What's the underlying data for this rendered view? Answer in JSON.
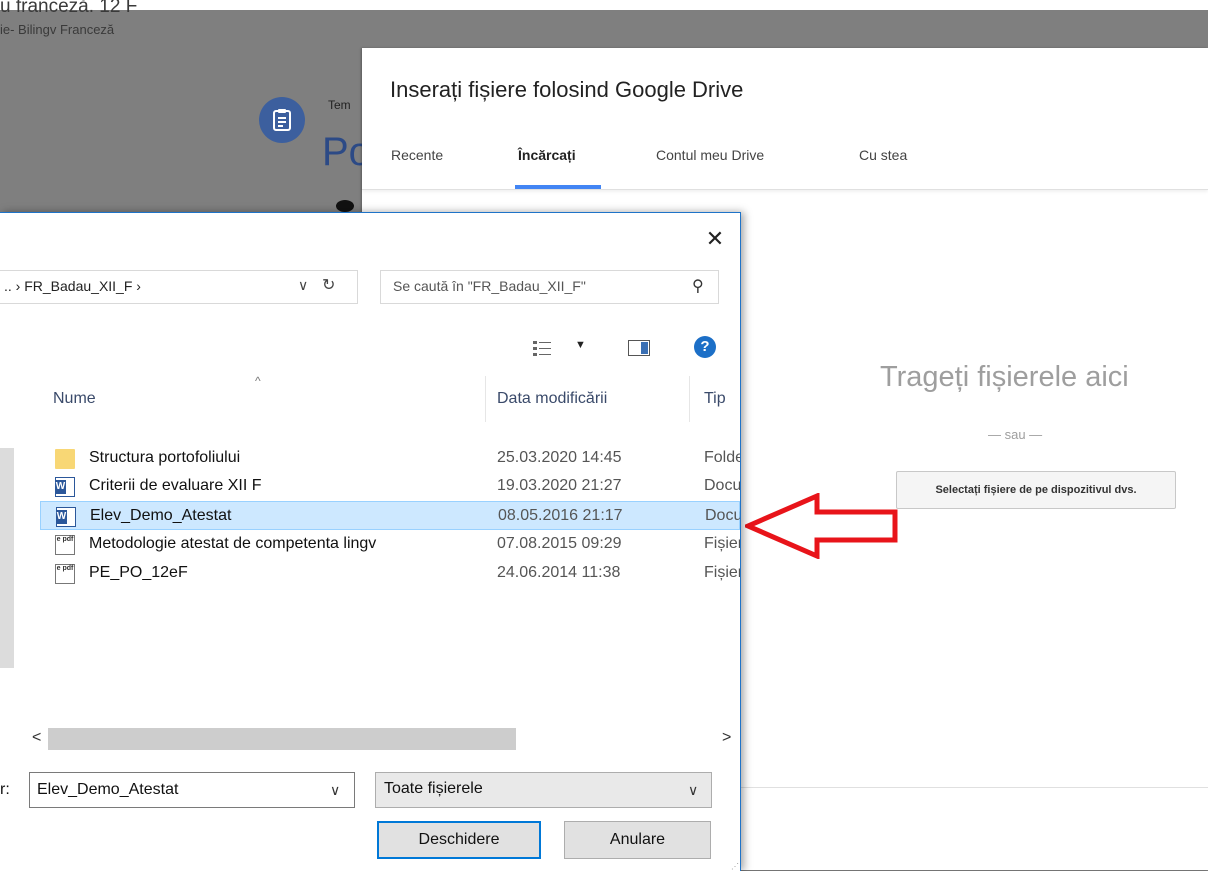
{
  "background_page": {
    "title": "u franceză. 12 F",
    "subtitle": "ie- Bilingv Franceză",
    "label_fragment": "Tem",
    "title_fragment": "Po"
  },
  "picker": {
    "title": "Inserați fișiere folosind Google Drive",
    "tabs": [
      {
        "label": "Recente",
        "active": false
      },
      {
        "label": "Încărcați",
        "active": true
      },
      {
        "label": "Contul meu Drive",
        "active": false
      },
      {
        "label": "Cu stea",
        "active": false
      }
    ],
    "drop_text": "Trageți fișierele aici",
    "or_text": "— sau —",
    "select_button": "Selectați fișiere de pe dispozitivul dvs.",
    "accent_color": "#4285f4"
  },
  "annotation": {
    "arrow_color": "#e8141a"
  },
  "dialog": {
    "close_glyph": "✕",
    "breadcrumb": ".. ›  FR_Badau_XII_F  ›",
    "chevron_glyph": "∨",
    "refresh_glyph": "↻",
    "search_placeholder": "Se caută în \"FR_Badau_XII_F\"",
    "search_glyph": "⚲",
    "help_glyph": "?",
    "view_caret": "▼",
    "columns": {
      "name": "Nume",
      "date": "Data modificării",
      "type": "Tip",
      "sort_glyph": "^"
    },
    "files": [
      {
        "name": "Structura portofoliului",
        "date": "25.03.2020 14:45",
        "type": "Folder",
        "icon": "folder-icon",
        "selected": false
      },
      {
        "name": "Criterii de evaluare XII  F",
        "date": "19.03.2020 21:27",
        "type": "Document",
        "icon": "word-doc-icon",
        "selected": false
      },
      {
        "name": "Elev_Demo_Atestat",
        "date": "08.05.2016 21:17",
        "type": "Document",
        "icon": "word-doc-icon",
        "selected": true
      },
      {
        "name": "Metodologie atestat de competenta lingv",
        "date": "07.08.2015 09:29",
        "type": "Fișier",
        "icon": "pdf-file-icon",
        "selected": false
      },
      {
        "name": "PE_PO_12eF",
        "date": "24.06.2014 11:38",
        "type": "Fișier",
        "icon": "pdf-file-icon",
        "selected": false
      }
    ],
    "scroll_left_glyph": "<",
    "scroll_right_glyph": ">",
    "file_name_label": "r:",
    "file_name_value": "Elev_Demo_Atestat",
    "file_type_value": "Toate fișierele",
    "open_button": "Deschidere",
    "cancel_button": "Anulare",
    "word_badge": "W",
    "pdf_badge": "e pdf",
    "selection_color": "#cde8ff"
  }
}
